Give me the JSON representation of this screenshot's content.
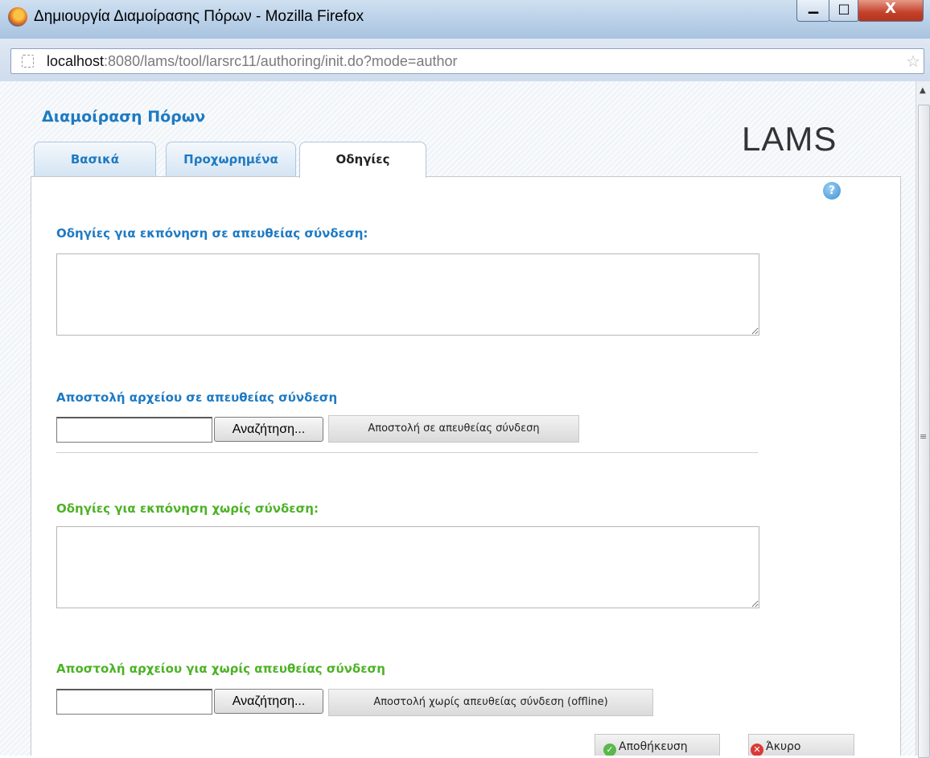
{
  "window": {
    "title": "Δημιουργία Διαμοίρασης Πόρων - Mozilla Firefox",
    "min_symbol": "▁",
    "max_symbol": "□",
    "close_symbol": "X"
  },
  "addressbar": {
    "host": "localhost",
    "path": ":8080/lams/tool/larsrc11/authoring/init.do?mode=author"
  },
  "page": {
    "title": "Διαμοίραση Πόρων",
    "logo": "LAMS",
    "tabs": [
      {
        "label": "Βασικά",
        "active": false
      },
      {
        "label": "Προχωρημένα",
        "active": false
      },
      {
        "label": "Οδηγίες",
        "active": true
      }
    ],
    "help_label": "?"
  },
  "online": {
    "instructions_label": "Οδηγίες για εκπόνηση σε απευθείας σύνδεση:",
    "instructions_value": "",
    "upload_label": "Αποστολή αρχείου σε απευθείας σύνδεση",
    "browse_button": "Αναζήτηση...",
    "upload_button": "Αποστολή σε απευθείας σύνδεση"
  },
  "offline": {
    "instructions_label": "Οδηγίες για εκπόνηση χωρίς σύνδεση:",
    "instructions_value": "",
    "upload_label": "Αποστολή αρχείου για χωρίς απευθείας σύνδεση",
    "browse_button": "Αναζήτηση...",
    "upload_button": "Αποστολή χωρίς απευθείας σύνδεση (offline)"
  },
  "actions": {
    "save": "Αποθήκευση",
    "cancel": "Άκυρο"
  },
  "colors": {
    "heading_blue": "#1e7ac3",
    "heading_green": "#4db226"
  },
  "icons": [
    "firefox-icon",
    "page-icon",
    "bookmark-star-icon",
    "help-icon",
    "check-icon",
    "cancel-icon"
  ]
}
